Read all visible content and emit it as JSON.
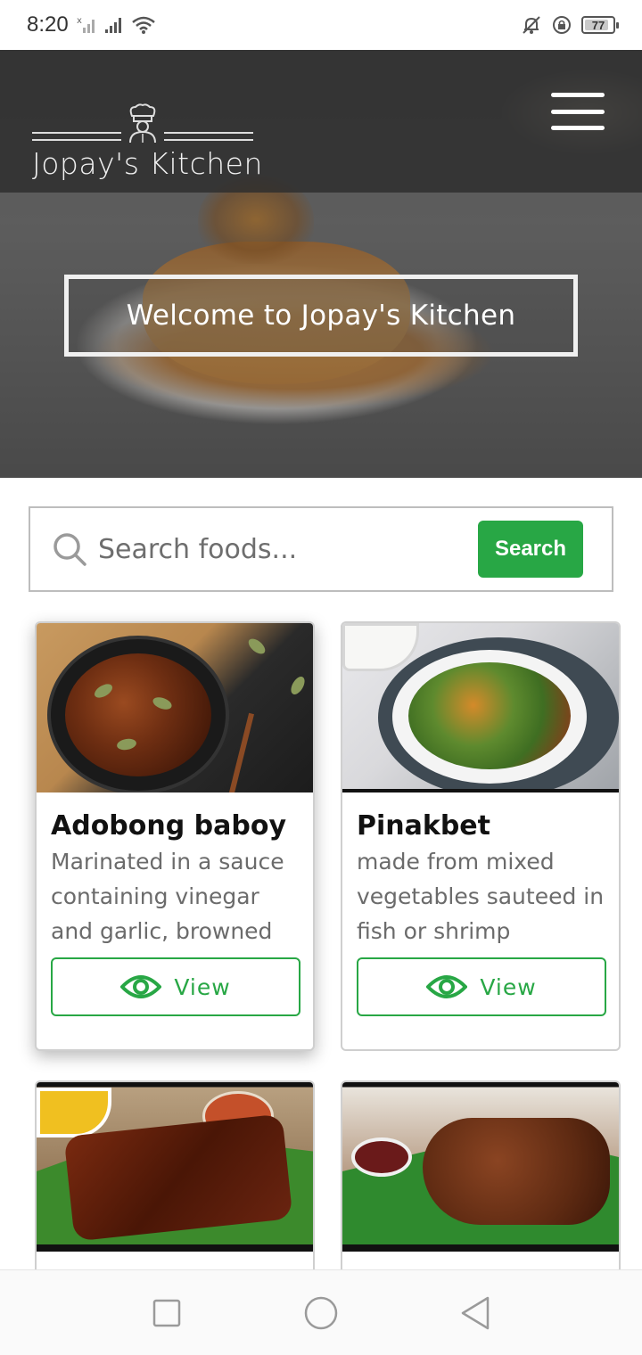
{
  "status_bar": {
    "time": "8:20",
    "battery": "77",
    "icons": [
      "signal-x-icon",
      "signal-icon",
      "wifi-icon",
      "bell-off-icon",
      "lock-rotation-icon",
      "battery-icon"
    ]
  },
  "header": {
    "brand": "Jopay's Kitchen",
    "logo_icon": "chef-icon",
    "menu_icon": "hamburger-menu-icon"
  },
  "hero": {
    "welcome_text": "Welcome to Jopay's Kitchen"
  },
  "search": {
    "placeholder": "Search foods...",
    "value": "",
    "button_label": "Search",
    "icon": "search-icon"
  },
  "foods": [
    {
      "title": "Adobong baboy",
      "description": "Marinated in a sauce containing vinegar and garlic, browned",
      "button_label": "View"
    },
    {
      "title": "Pinakbet",
      "description": "made from mixed vegetables sauteed in fish or shrimp",
      "button_label": "View"
    },
    {
      "title": "",
      "description": "",
      "button_label": ""
    },
    {
      "title": "",
      "description": "",
      "button_label": ""
    }
  ],
  "system_nav": {
    "icons": [
      "recent-apps-icon",
      "home-icon",
      "back-icon"
    ]
  },
  "colors": {
    "accent": "#28a745",
    "nav_overlay": "#2d2d2d",
    "text_dark": "#111111",
    "text_muted": "#6b6b6b"
  }
}
